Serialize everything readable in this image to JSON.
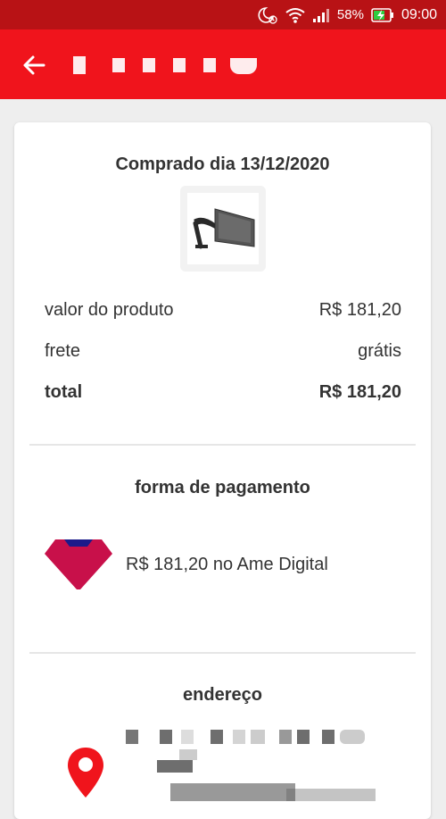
{
  "status_bar": {
    "battery": "58%",
    "time": "09:00",
    "icons": [
      "moon-alarm-icon",
      "wifi-icon",
      "signal-icon",
      "battery-charging-icon"
    ]
  },
  "app_bar": {
    "back_icon": "arrow-left-icon",
    "title": ""
  },
  "order": {
    "purchase_date": "Comprado dia 13/12/2020",
    "product_image": "monitor-arm-icon",
    "rows": [
      {
        "label": "valor do produto",
        "value": "R$ 181,20"
      },
      {
        "label": "frete",
        "value": "grátis"
      },
      {
        "label": "total",
        "value": "R$ 181,20"
      }
    ]
  },
  "payment": {
    "title": "forma de pagamento",
    "logo": "ame-digital-logo",
    "description": "R$ 181,20 no Ame Digital"
  },
  "address": {
    "title": "endereço",
    "icon": "location-pin-icon"
  },
  "colors": {
    "status_bar": "#b81215",
    "app_bar": "#f0141c",
    "background": "#eeeeee",
    "card": "#ffffff",
    "ame_logo": "#c8104a",
    "ame_logo_accent": "#1c1a8a",
    "pin": "#f0141c"
  }
}
